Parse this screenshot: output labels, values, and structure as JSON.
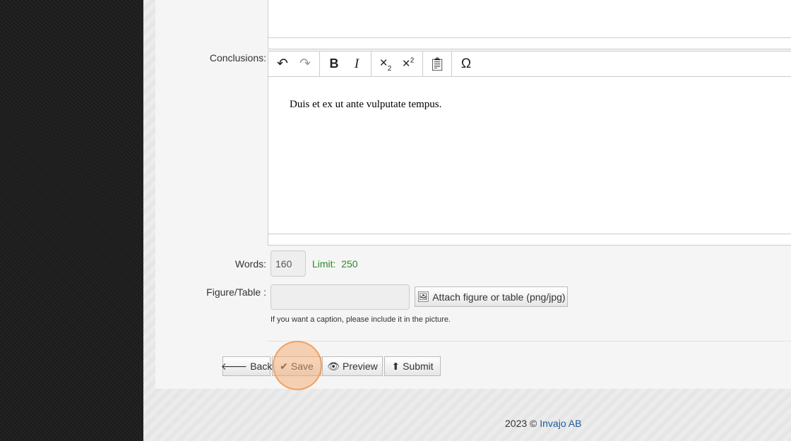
{
  "form": {
    "conclusions_label": "Conclusions:",
    "conclusions_text": "Duis et ex ut ante vulputate tempus.",
    "words_label": "Words:",
    "words_value": "160",
    "limit_label": "Limit:",
    "limit_value": "250",
    "figure_label": "Figure/Table :",
    "figure_value": "",
    "attach_label": "Attach figure or table (png/jpg)",
    "caption_hint": "If you want a caption, please include it in the picture."
  },
  "toolbar": {
    "icons": [
      "undo-icon",
      "redo-icon",
      "bold-icon",
      "italic-icon",
      "subscript-icon",
      "superscript-icon",
      "paste-icon",
      "omega-icon"
    ]
  },
  "buttons": {
    "back": "Back",
    "save": "Save",
    "preview": "Preview",
    "submit": "Submit"
  },
  "footer": {
    "copyright": "2023 ©",
    "company": "Invajo AB"
  },
  "colors": {
    "limit": "#2a8a2a",
    "link": "#1a5a9a",
    "highlight": "#f6aa6e"
  }
}
